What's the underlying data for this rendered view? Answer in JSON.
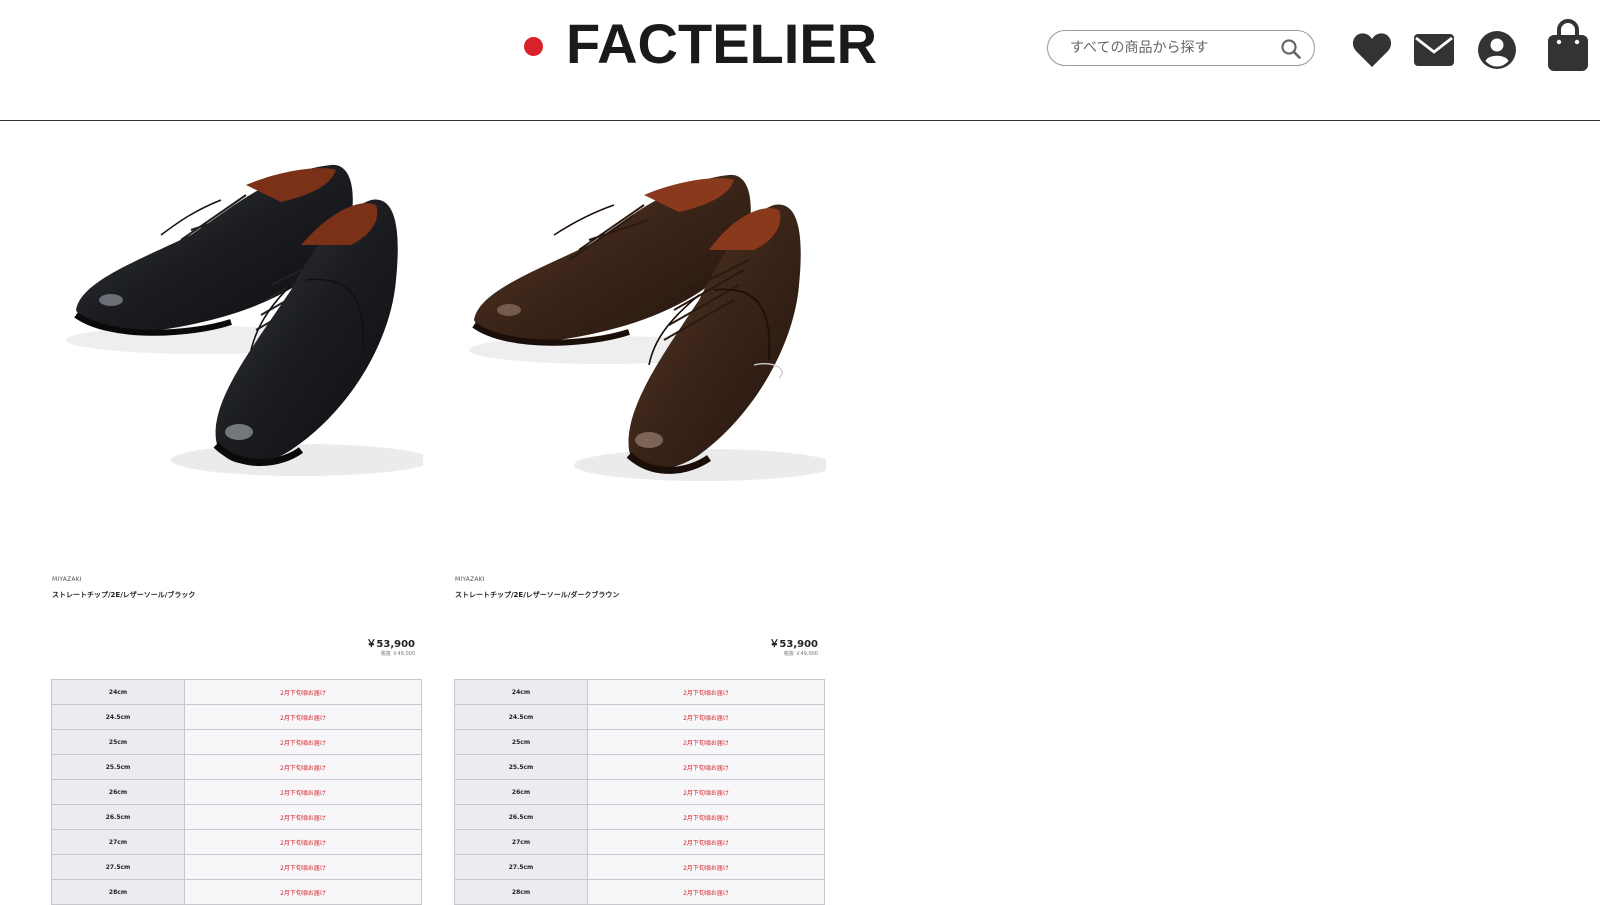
{
  "header": {
    "logo_text": "FACTELIER",
    "search": {
      "placeholder": "すべての商品から探す"
    },
    "icons": [
      "heart-icon",
      "mail-icon",
      "account-icon",
      "bag-icon"
    ]
  },
  "colors": {
    "accent": "#d8212a",
    "text": "#1a1a1a",
    "table_size_bg": "#ebecef",
    "table_status_bg": "#f7f7f9"
  },
  "products": [
    {
      "brand": "MIYAZAKI",
      "name": "ストレートチップ/2E/レザーソール/ブラック",
      "price": "￥53,900",
      "price_sub": "税抜 ￥49,000",
      "color": "black",
      "sizes": [
        {
          "size": "24cm",
          "status": "2月下旬頃お届け"
        },
        {
          "size": "24.5cm",
          "status": "2月下旬頃お届け"
        },
        {
          "size": "25cm",
          "status": "2月下旬頃お届け"
        },
        {
          "size": "25.5cm",
          "status": "2月下旬頃お届け"
        },
        {
          "size": "26cm",
          "status": "2月下旬頃お届け"
        },
        {
          "size": "26.5cm",
          "status": "2月下旬頃お届け"
        },
        {
          "size": "27cm",
          "status": "2月下旬頃お届け"
        },
        {
          "size": "27.5cm",
          "status": "2月下旬頃お届け"
        },
        {
          "size": "28cm",
          "status": "2月下旬頃お届け"
        }
      ]
    },
    {
      "brand": "MIYAZAKI",
      "name": "ストレートチップ/2E/レザーソール/ダークブラウン",
      "price": "￥53,900",
      "price_sub": "税抜 ￥49,000",
      "color": "dark-brown",
      "sizes": [
        {
          "size": "24cm",
          "status": "2月下旬頃お届け"
        },
        {
          "size": "24.5cm",
          "status": "2月下旬頃お届け"
        },
        {
          "size": "25cm",
          "status": "2月下旬頃お届け"
        },
        {
          "size": "25.5cm",
          "status": "2月下旬頃お届け"
        },
        {
          "size": "26cm",
          "status": "2月下旬頃お届け"
        },
        {
          "size": "26.5cm",
          "status": "2月下旬頃お届け"
        },
        {
          "size": "27cm",
          "status": "2月下旬頃お届け"
        },
        {
          "size": "27.5cm",
          "status": "2月下旬頃お届け"
        },
        {
          "size": "28cm",
          "status": "2月下旬頃お届け"
        }
      ]
    }
  ]
}
